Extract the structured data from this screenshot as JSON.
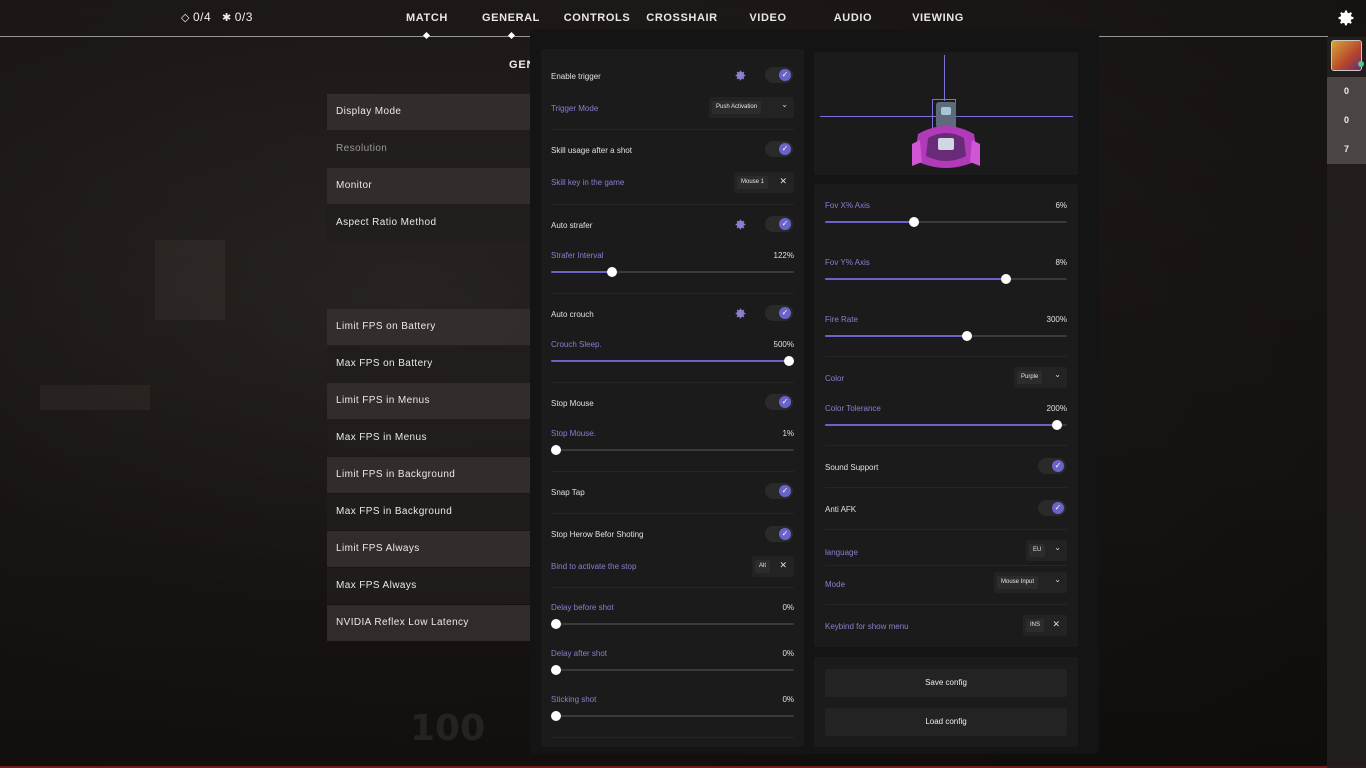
{
  "topbar": {
    "counter_diamond": "0/4",
    "counter_star": "0/3",
    "tabs": [
      "MATCH",
      "GENERAL",
      "CONTROLS",
      "CROSSHAIR",
      "VIDEO",
      "AUDIO",
      "VIEWING"
    ],
    "active_tab": "VIDEO"
  },
  "rail": {
    "values": [
      "0",
      "0",
      "7"
    ]
  },
  "settings": {
    "section_title": "GEN",
    "items": [
      "Display Mode",
      "Resolution",
      "Monitor",
      "Aspect Ratio Method",
      "Limit FPS on Battery",
      "Max FPS on Battery",
      "Limit FPS in Menus",
      "Max FPS in Menus",
      "Limit FPS in Background",
      "Max FPS in Background",
      "Limit FPS Always",
      "Max FPS Always",
      "NVIDIA Reflex Low Latency"
    ]
  },
  "background": {
    "number": "100"
  },
  "panel": {
    "left": {
      "enable_trigger": "Enable trigger",
      "trigger_mode_label": "Trigger Mode",
      "trigger_mode_value": "Push Activation",
      "skill_usage": "Skill usage after a shot",
      "skill_key_label": "Skill key in the game",
      "skill_key_value": "Mouse 1",
      "auto_strafer": "Auto strafer",
      "strafer_interval_label": "Strafer Interval",
      "strafer_interval_value": "122%",
      "strafer_interval_level": 0.24,
      "auto_crouch": "Auto crouch",
      "crouch_sleep_label": "Crouch Sleep.",
      "crouch_sleep_value": "500%",
      "crouch_sleep_level": 1.0,
      "stop_mouse": "Stop Mouse",
      "stop_mouse_sub_label": "Stop Mouse.",
      "stop_mouse_sub_value": "1%",
      "stop_mouse_level": 0.0,
      "snap_tap": "Snap Tap",
      "stop_herow": "Stop Herow Befor Shoting",
      "bind_stop_label": "Bind to activate the stop",
      "bind_stop_value": "Alt",
      "delay_before_label": "Delay before shot",
      "delay_before_value": "0%",
      "delay_before_level": 0.0,
      "delay_after_label": "Delay after shot",
      "delay_after_value": "0%",
      "delay_after_level": 0.0,
      "sticking_label": "Sticking shot",
      "sticking_value": "0%",
      "sticking_level": 0.0
    },
    "right": {
      "fov_x_label": "Fov X% Axis",
      "fov_x_value": "6%",
      "fov_x_level": 0.36,
      "fov_y_label": "Fov Y% Axis",
      "fov_y_value": "8%",
      "fov_y_level": 0.76,
      "fire_rate_label": "Fire Rate",
      "fire_rate_value": "300%",
      "fire_rate_level": 0.59,
      "color_label": "Color",
      "color_value": "Purple",
      "color_tol_label": "Color Tolerance",
      "color_tol_value": "200%",
      "color_tol_level": 0.98,
      "sound_support": "Sound Support",
      "anti_afk": "Anti AFK",
      "language_label": "language",
      "language_value": "EU",
      "mode_label": "Mode",
      "mode_value": "Mouse Input",
      "keybind_label": "Keybind for show menu",
      "keybind_value": "INS",
      "save_button": "Save config",
      "load_button": "Load config"
    },
    "colors": {
      "accent": "#6a63c9",
      "label_sub": "#8a7fd0"
    }
  }
}
